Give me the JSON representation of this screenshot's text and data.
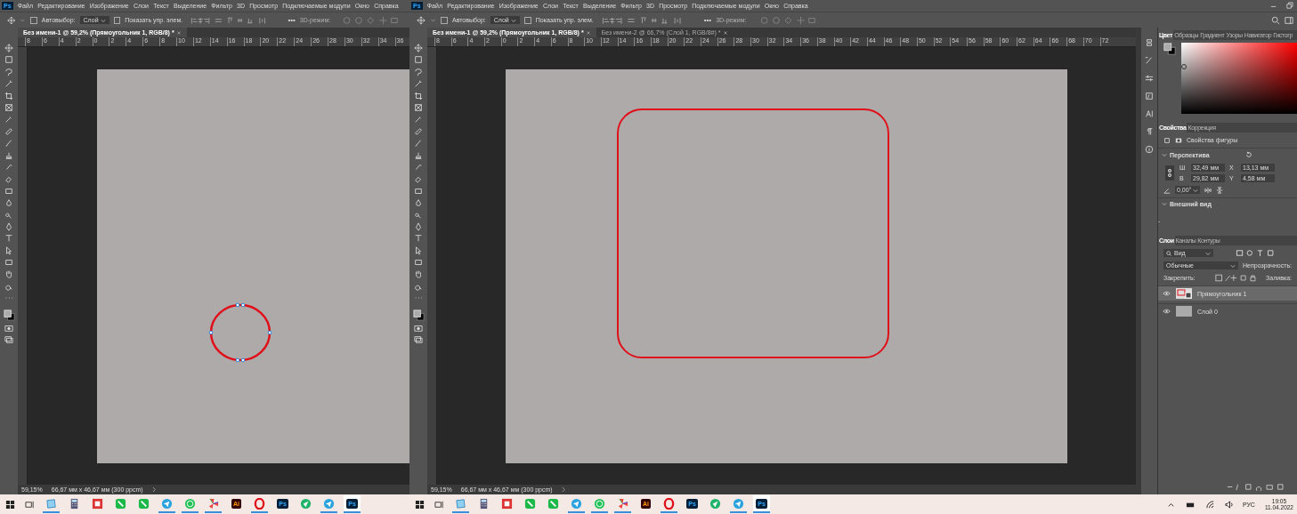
{
  "windows": [
    {
      "app_logo": "Ps",
      "menu": [
        "Файл",
        "Редактирование",
        "Изображение",
        "Слои",
        "Текст",
        "Выделение",
        "Фильтр",
        "3D",
        "Просмотр",
        "Подключаемые модули",
        "Окно",
        "Справка"
      ],
      "options": {
        "autoselect": {
          "label": "Автовыбор:",
          "checked": false
        },
        "target": "Слой",
        "show_controls": {
          "label": "Показать упр. элем.",
          "checked": false
        },
        "more": "•••",
        "mode3d": "3D-режим:"
      },
      "tabs": [
        {
          "label": "Без имени-1 @ 59,2% (Прямоугольник 1, RGB/8) *",
          "selected": true
        }
      ],
      "ruler": [
        "8",
        "6",
        "4",
        "2",
        "0",
        "2",
        "4",
        "6",
        "8",
        "10",
        "12",
        "14",
        "16",
        "18",
        "20",
        "22",
        "24",
        "26",
        "28",
        "30",
        "32",
        "34",
        "36"
      ],
      "shape": {
        "kind": "ellipse",
        "selected": true
      },
      "status": {
        "zoom": "59,15%",
        "size": "66,67 мм x 46,67 мм (300 ppcm)"
      },
      "taskbar": [
        {
          "kind": "notes",
          "running": true,
          "selected": false
        },
        {
          "kind": "calc",
          "running": false,
          "selected": false
        },
        {
          "kind": "square",
          "running": false,
          "selected": false
        },
        {
          "kind": "phone",
          "running": false,
          "selected": false
        },
        {
          "kind": "phone",
          "running": false,
          "selected": false
        },
        {
          "kind": "telegram",
          "running": true,
          "selected": false
        },
        {
          "kind": "whatsapp",
          "running": true,
          "selected": false
        },
        {
          "kind": "pinwheel",
          "running": true,
          "selected": false
        },
        {
          "kind": "badge",
          "label": "Ai",
          "running": false,
          "selected": false
        },
        {
          "kind": "opera",
          "running": true,
          "selected": false
        },
        {
          "kind": "badge",
          "label": "Ps",
          "running": false,
          "selected": false
        },
        {
          "kind": "send",
          "running": false,
          "selected": false
        },
        {
          "kind": "telegram",
          "running": true,
          "selected": false
        },
        {
          "kind": "badge",
          "label": "Ps",
          "running": true,
          "selected": true
        }
      ]
    },
    {
      "app_logo": "Ps",
      "menu": [
        "Файл",
        "Редактирование",
        "Изображение",
        "Слои",
        "Текст",
        "Выделение",
        "Фильтр",
        "3D",
        "Просмотр",
        "Подключаемые модули",
        "Окно",
        "Справка"
      ],
      "options": {
        "autoselect": {
          "label": "Автовыбор:",
          "checked": false
        },
        "target": "Слой",
        "show_controls": {
          "label": "Показать упр. элем.",
          "checked": false
        },
        "more": "•••",
        "mode3d": "3D-режим:"
      },
      "tabs": [
        {
          "label": "Без имени-1 @ 59,2% (Прямоугольник 1, RGB/8) *",
          "selected": true
        },
        {
          "label": "Без имени-2 @ 66,7% (Слой 1, RGB/8#) *",
          "selected": false
        }
      ],
      "ruler": [
        "8",
        "6",
        "4",
        "2",
        "0",
        "2",
        "4",
        "6",
        "8",
        "10",
        "12",
        "14",
        "16",
        "18",
        "20",
        "22",
        "24",
        "26",
        "28",
        "30",
        "32",
        "34",
        "36",
        "38",
        "40",
        "42",
        "44",
        "46",
        "48",
        "50",
        "52",
        "54",
        "56",
        "58",
        "60",
        "62",
        "64",
        "66",
        "68",
        "70",
        "72"
      ],
      "shape": {
        "kind": "rounded-rect",
        "selected": false
      },
      "status": {
        "zoom": "59,15%",
        "size": "66,67 мм x 46,67 мм (300 ppcm)"
      },
      "panels": {
        "color_tabs": [
          {
            "label": "Цвет",
            "selected": true
          },
          {
            "label": "Образцы",
            "selected": false
          },
          {
            "label": "Градиент",
            "selected": false
          },
          {
            "label": "Узоры",
            "selected": false
          },
          {
            "label": "Навигатор",
            "selected": false
          },
          {
            "label": "Гистогр",
            "selected": false
          }
        ],
        "props_tabs": [
          {
            "label": "Свойства",
            "selected": true
          },
          {
            "label": "Коррекция",
            "selected": false
          }
        ],
        "shape_props": "Свойства фигуры",
        "transform": {
          "title": "Перспектива",
          "fields": [
            {
              "label": "Ш",
              "value": "32,49 мм"
            },
            {
              "label": "X",
              "value": "13,13 мм"
            },
            {
              "label": "В",
              "value": "29,82 мм"
            },
            {
              "label": "Y",
              "value": "4,58 мм"
            }
          ],
          "angle": "0,00°"
        },
        "appearance": {
          "title": "Внешний вид",
          "stroke_dash": "-"
        },
        "layer_tabs": [
          {
            "label": "Слои",
            "selected": true
          },
          {
            "label": "Каналы",
            "selected": false
          },
          {
            "label": "Контуры",
            "selected": false
          }
        ],
        "filter": "Вид",
        "blend": "Обычные",
        "opacity_label": "Непрозрачность:",
        "lock_label": "Закрепить:",
        "fill_label": "Заливка:",
        "layers": [
          {
            "name": "Прямоугольник 1",
            "visible": true,
            "selected": true,
            "kind": "shape"
          },
          {
            "name": "Слой 0",
            "visible": true,
            "selected": false,
            "kind": "fill"
          }
        ]
      },
      "taskbar": [
        {
          "kind": "notes",
          "running": true,
          "selected": false
        },
        {
          "kind": "calc",
          "running": false,
          "selected": false
        },
        {
          "kind": "square",
          "running": false,
          "selected": false
        },
        {
          "kind": "phone",
          "running": false,
          "selected": false
        },
        {
          "kind": "phone",
          "running": false,
          "selected": false
        },
        {
          "kind": "telegram",
          "running": true,
          "selected": false
        },
        {
          "kind": "whatsapp",
          "running": true,
          "selected": false
        },
        {
          "kind": "pinwheel",
          "running": true,
          "selected": false
        },
        {
          "kind": "badge",
          "label": "Ai",
          "running": false,
          "selected": false
        },
        {
          "kind": "opera",
          "running": true,
          "selected": false
        },
        {
          "kind": "badge",
          "label": "Ps",
          "running": false,
          "selected": false
        },
        {
          "kind": "send",
          "running": false,
          "selected": false
        },
        {
          "kind": "telegram",
          "running": true,
          "selected": false
        },
        {
          "kind": "badge",
          "label": "Ps",
          "running": true,
          "selected": true
        }
      ],
      "tray": {
        "language": "РУС",
        "time": "19:05",
        "date": "11.04.2022"
      }
    }
  ]
}
